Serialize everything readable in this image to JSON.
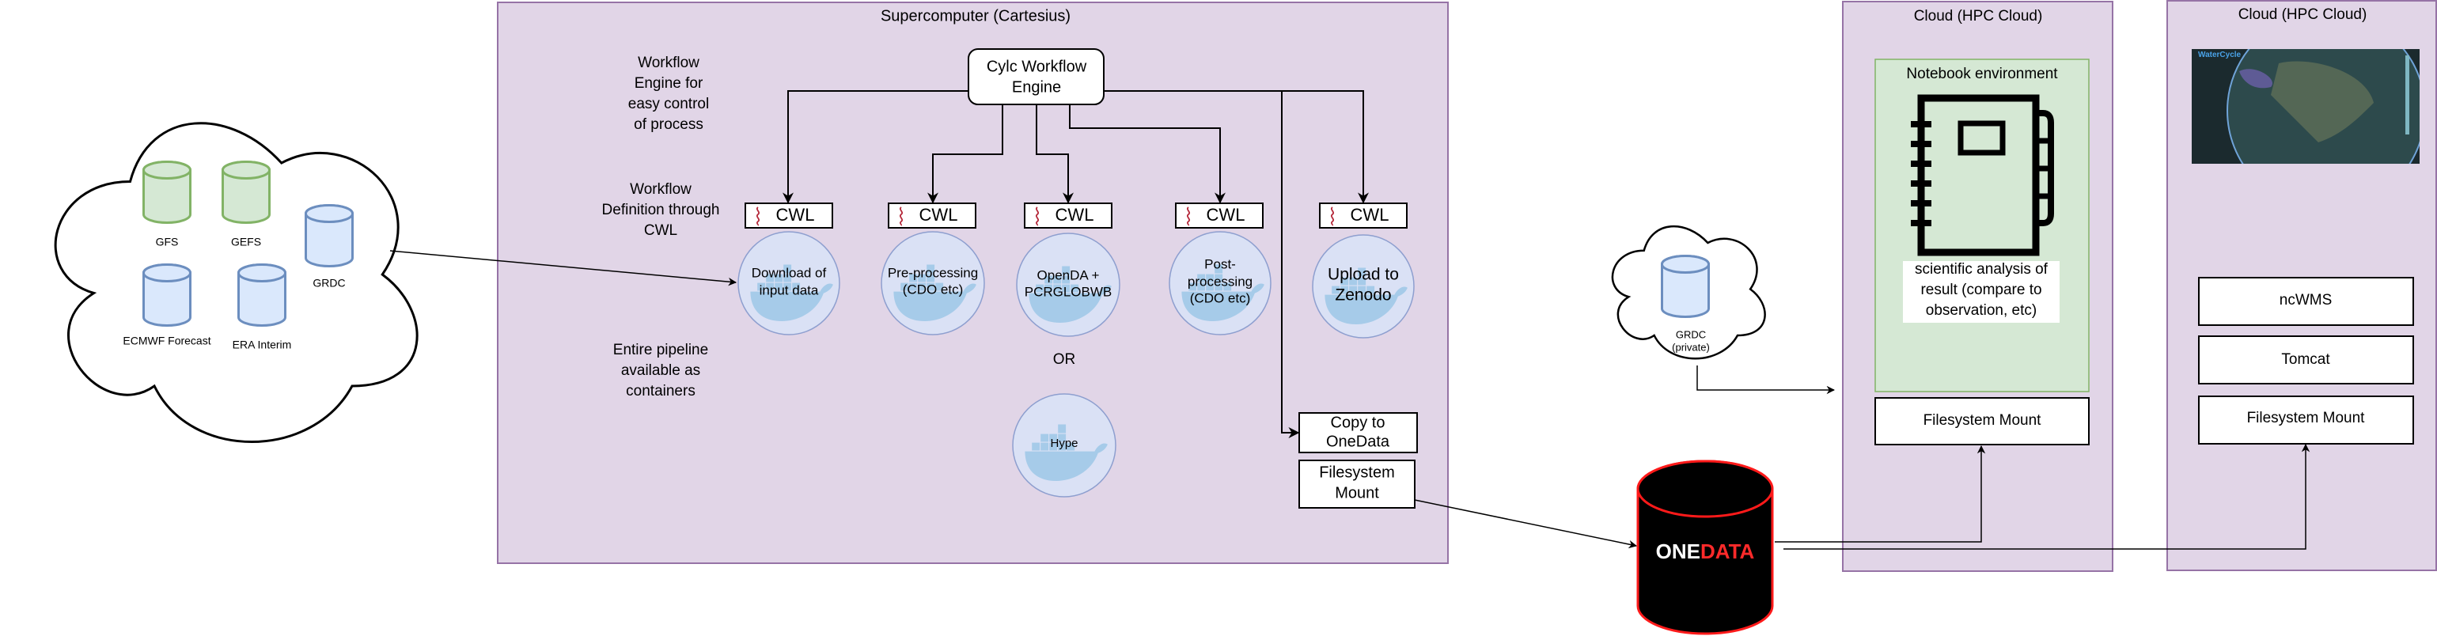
{
  "colors": {
    "panel_fill": "#e1d5e7",
    "panel_border": "#9673a6",
    "green_cylinder": "#d5e8d4",
    "blue_cylinder": "#dae8fc",
    "container_circle": "#dae1f5",
    "docker_whale": "#a6cbe9",
    "onedata_red": "#ff1a1a"
  },
  "external_data_cloud": {
    "datasets": [
      {
        "label": "GFS",
        "color": "green"
      },
      {
        "label": "GEFS",
        "color": "green"
      },
      {
        "label": "GRDC",
        "color": "blue"
      },
      {
        "label": "ECMWF Forecast",
        "color": "blue"
      },
      {
        "label": "ERA Interim",
        "color": "blue"
      }
    ]
  },
  "supercomputer": {
    "title": "Supercomputer (Cartesius)",
    "engine_label": [
      "Cylc Workflow",
      "Engine"
    ],
    "notes": {
      "engine": [
        "Workflow",
        "Engine for",
        "easy control",
        "of process"
      ],
      "definition": [
        "Workflow",
        "Definition through",
        "CWL"
      ],
      "containers": [
        "Entire pipeline",
        "available as",
        "containers"
      ]
    },
    "cwl_label": "CWL",
    "steps": [
      {
        "label": [
          "Download of",
          "input data"
        ]
      },
      {
        "label": [
          "Pre-processing",
          "(CDO etc)"
        ]
      },
      {
        "label": [
          "OpenDA +",
          "PCRGLOBWB"
        ]
      },
      {
        "label": [
          "Post-",
          "processing",
          "(CDO etc)"
        ]
      },
      {
        "label": [
          "Upload to",
          "Zenodo"
        ]
      }
    ],
    "or_label": "OR",
    "alt_model": "Hype",
    "copy_box": [
      "Copy to",
      "OneData"
    ],
    "mount_box": [
      "Filesystem",
      "Mount"
    ]
  },
  "private_cloud": {
    "dataset": [
      "GRDC",
      "(private)"
    ]
  },
  "onedata": {
    "logo_part1": "ONE",
    "logo_part2": "DATA"
  },
  "cloud_notebook": {
    "title": "Cloud (HPC Cloud)",
    "env_title": "Notebook environment",
    "icon": "notebook-icon",
    "analysis": [
      "scientific analysis of",
      "result (compare to",
      "observation, etc)"
    ],
    "mount": "Filesystem Mount"
  },
  "cloud_viewer": {
    "title": "Cloud (HPC Cloud)",
    "screenshot_logo": "WaterCycle",
    "services": [
      "ncWMS",
      "Tomcat",
      "Filesystem Mount"
    ]
  }
}
